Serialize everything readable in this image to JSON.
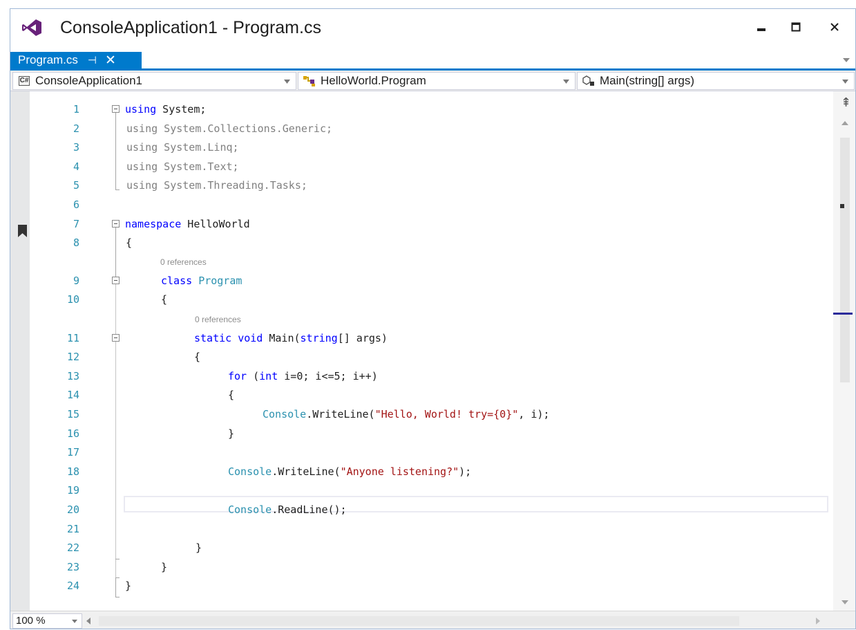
{
  "window": {
    "title": "ConsoleApplication1 - Program.cs",
    "controls": {
      "minimize_icon": "minimize-icon",
      "maximize_icon": "maximize-icon",
      "close_icon": "close-icon"
    }
  },
  "tabs": [
    {
      "label": "Program.cs",
      "pin_glyph": "⊣",
      "close_glyph": "✕",
      "active": true
    }
  ],
  "navigation_bar": {
    "project": {
      "value": "ConsoleApplication1",
      "badge": "C#"
    },
    "type": {
      "value": "HelloWorld.Program"
    },
    "member": {
      "value": "Main(string[] args)"
    }
  },
  "editor": {
    "line_numbers": [
      "1",
      "2",
      "3",
      "4",
      "5",
      "6",
      "7",
      "8",
      "9",
      "10",
      "11",
      "12",
      "13",
      "14",
      "15",
      "16",
      "17",
      "18",
      "19",
      "20",
      "21",
      "22",
      "23",
      "24"
    ],
    "code_lens": {
      "class": "0 references",
      "method": "0 references"
    },
    "current_line": 20,
    "bookmark_line": 7,
    "lines": {
      "l1": {
        "kw": "using",
        "rest": " System;"
      },
      "l2": "using System.Collections.Generic;",
      "l3": "using System.Linq;",
      "l4": "using System.Text;",
      "l5": "using System.Threading.Tasks;",
      "l7": {
        "kw": "namespace",
        "rest": " HelloWorld"
      },
      "l8": "{",
      "l9": {
        "kw": "class",
        "type": "Program"
      },
      "l10": "{",
      "l11": {
        "kw1": "static",
        "kw2": "void",
        "mid": " Main(",
        "kw3": "string",
        "rest": "[] args)"
      },
      "l12": "{",
      "l13": {
        "kw1": "for",
        "mid1": " (",
        "kw2": "int",
        "rest": " i=0; i<=5; i++)"
      },
      "l14": "{",
      "l15": {
        "type": "Console",
        "mid": ".WriteLine(",
        "str": "\"Hello, World! try={0}\"",
        "rest": ", i);"
      },
      "l16": "}",
      "l18": {
        "type": "Console",
        "mid": ".WriteLine(",
        "str": "\"Anyone listening?\"",
        "rest": ");"
      },
      "l20": {
        "type": "Console",
        "rest": ".ReadLine();"
      },
      "l22": "}",
      "l23": "}",
      "l24": "}"
    }
  },
  "status": {
    "zoom": "100 %"
  },
  "colors": {
    "accent": "#007acc",
    "keyword": "#0000ff",
    "type": "#2b91af",
    "string": "#a31515",
    "line_number": "#2b91af"
  }
}
